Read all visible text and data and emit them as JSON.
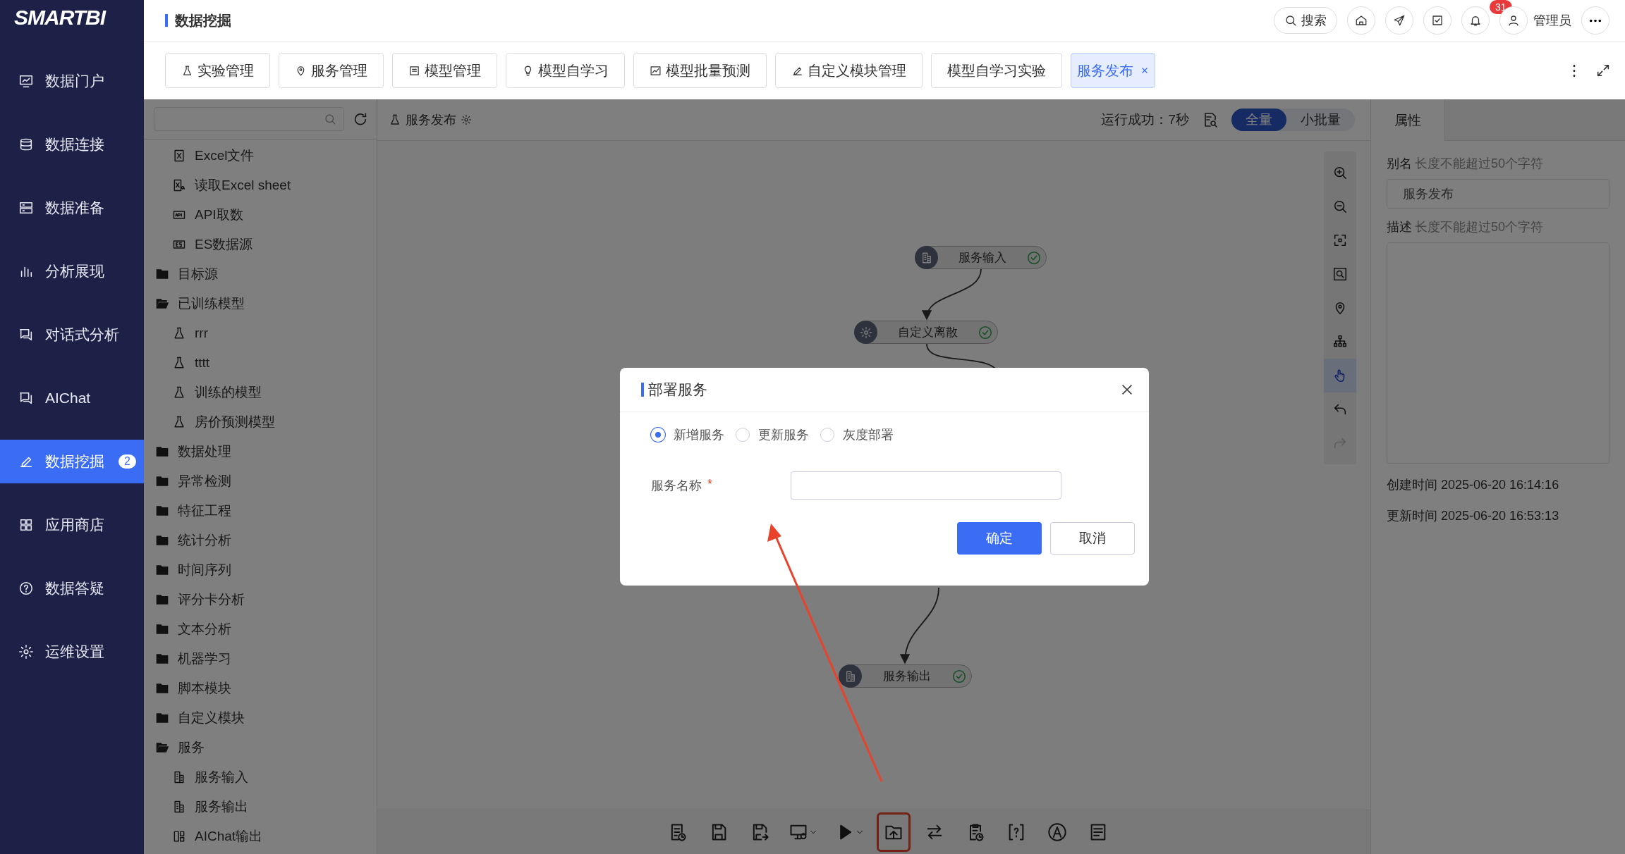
{
  "logo": "SMARTBI",
  "sidebar": {
    "items": [
      {
        "label": "数据门户",
        "kind": "portal",
        "selected": false
      },
      {
        "label": "数据连接",
        "kind": "database",
        "selected": false
      },
      {
        "label": "数据准备",
        "kind": "server",
        "selected": false
      },
      {
        "label": "分析展现",
        "kind": "bars",
        "selected": false
      },
      {
        "label": "对话式分析",
        "kind": "chat",
        "selected": false
      },
      {
        "label": "AIChat",
        "kind": "chat",
        "selected": false
      },
      {
        "label": "数据挖掘",
        "kind": "pen",
        "selected": true,
        "badge": "2"
      },
      {
        "label": "应用商店",
        "kind": "grid",
        "selected": false
      },
      {
        "label": "数据答疑",
        "kind": "question",
        "selected": false
      },
      {
        "label": "运维设置",
        "kind": "gear",
        "selected": false
      }
    ]
  },
  "header": {
    "title": "数据挖掘",
    "search": {
      "label": "搜索"
    },
    "notifications": {
      "count": "31"
    },
    "user": {
      "name": "管理员"
    }
  },
  "tabs": [
    {
      "label": "实验管理",
      "kind": "flask",
      "selected": false
    },
    {
      "label": "服务管理",
      "kind": "pin",
      "selected": false
    },
    {
      "label": "模型管理",
      "kind": "card",
      "selected": false
    },
    {
      "label": "模型自学习",
      "kind": "bulb",
      "selected": false
    },
    {
      "label": "模型批量预测",
      "kind": "chart",
      "selected": false
    },
    {
      "label": "自定义模块管理",
      "kind": "pen",
      "selected": false
    },
    {
      "label": "模型自学习实验",
      "kind": "plain",
      "selected": false
    },
    {
      "label": "服务发布",
      "kind": "plain",
      "selected": true,
      "closable": true
    }
  ],
  "tree": {
    "items": [
      {
        "label": "Excel文件",
        "kind": "excel"
      },
      {
        "label": "读取Excel sheet",
        "kind": "sheet"
      },
      {
        "label": "API取数",
        "kind": "api"
      },
      {
        "label": "ES数据源",
        "kind": "es"
      },
      {
        "label": "目标源",
        "kind": "folder",
        "expanded": false
      },
      {
        "label": "已训练模型",
        "kind": "folder",
        "expanded": true,
        "children": [
          {
            "label": "rrr",
            "kind": "flask"
          },
          {
            "label": "tttt",
            "kind": "flask"
          },
          {
            "label": "训练的模型",
            "kind": "flask"
          },
          {
            "label": "房价预测模型",
            "kind": "flask"
          }
        ]
      },
      {
        "label": "数据处理",
        "kind": "folder",
        "expanded": false
      },
      {
        "label": "异常检测",
        "kind": "folder",
        "expanded": false
      },
      {
        "label": "特征工程",
        "kind": "folder",
        "expanded": false
      },
      {
        "label": "统计分析",
        "kind": "folder",
        "expanded": false
      },
      {
        "label": "时间序列",
        "kind": "folder",
        "expanded": false
      },
      {
        "label": "评分卡分析",
        "kind": "folder",
        "expanded": false
      },
      {
        "label": "文本分析",
        "kind": "folder",
        "expanded": false
      },
      {
        "label": "机器学习",
        "kind": "folder",
        "expanded": false
      },
      {
        "label": "脚本模块",
        "kind": "folder",
        "expanded": false
      },
      {
        "label": "自定义模块",
        "kind": "folder",
        "expanded": false
      },
      {
        "label": "服务",
        "kind": "folder",
        "expanded": true,
        "children": [
          {
            "label": "服务输入",
            "kind": "service"
          },
          {
            "label": "服务输出",
            "kind": "service"
          },
          {
            "label": "AIChat输出",
            "kind": "panel"
          }
        ]
      }
    ]
  },
  "canvas": {
    "title": "服务发布",
    "status": "运行成功：7秒",
    "modes": [
      {
        "label": "全量",
        "selected": true
      },
      {
        "label": "小批量",
        "selected": false
      }
    ],
    "nodes": [
      {
        "label": "服务输入",
        "success": true
      },
      {
        "label": "自定义离散",
        "success": true
      },
      {
        "label": "服务输出",
        "success": true
      }
    ],
    "tools": [
      {
        "kind": "zoom-in",
        "selected": false,
        "disabled": false
      },
      {
        "kind": "zoom-out",
        "selected": false,
        "disabled": false
      },
      {
        "kind": "fit",
        "selected": false,
        "disabled": false
      },
      {
        "kind": "frame-search",
        "selected": false,
        "disabled": false
      },
      {
        "kind": "location",
        "selected": false,
        "disabled": false
      },
      {
        "kind": "hierarchy",
        "selected": false,
        "disabled": false
      },
      {
        "kind": "hand",
        "selected": true,
        "disabled": false
      },
      {
        "kind": "undo",
        "selected": false,
        "disabled": false
      },
      {
        "kind": "redo",
        "selected": false,
        "disabled": true
      }
    ],
    "toolbar": [
      {
        "kind": "report-clock",
        "highlighted": false
      },
      {
        "kind": "save",
        "highlighted": false
      },
      {
        "kind": "save-export",
        "highlighted": false
      },
      {
        "kind": "monitor-gear",
        "highlighted": false
      },
      {
        "kind": "play",
        "highlighted": false
      },
      {
        "kind": "folder-upload",
        "highlighted": true
      },
      {
        "kind": "swap",
        "highlighted": false
      },
      {
        "kind": "clipboard-clock",
        "highlighted": false
      },
      {
        "kind": "bracket-question",
        "highlighted": false
      },
      {
        "kind": "circle-a",
        "highlighted": false
      },
      {
        "kind": "doc-lines",
        "highlighted": false
      }
    ]
  },
  "properties": {
    "tab": "属性",
    "alias": {
      "label": "别名",
      "hint": "长度不能超过50个字符",
      "value": "服务发布"
    },
    "description": {
      "label": "描述",
      "hint": "长度不能超过50个字符"
    },
    "created": "创建时间 2025-06-20 16:14:16",
    "updated": "更新时间 2025-06-20 16:53:13"
  },
  "dialog": {
    "title": "部署服务",
    "options": [
      {
        "label": "新增服务",
        "selected": true
      },
      {
        "label": "更新服务",
        "selected": false
      },
      {
        "label": "灰度部署",
        "selected": false
      }
    ],
    "field": {
      "label": "服务名称",
      "required_mark": "*"
    },
    "buttons": [
      {
        "label": "确定",
        "kind": "primary"
      },
      {
        "label": "取消",
        "kind": "secondary"
      }
    ]
  }
}
